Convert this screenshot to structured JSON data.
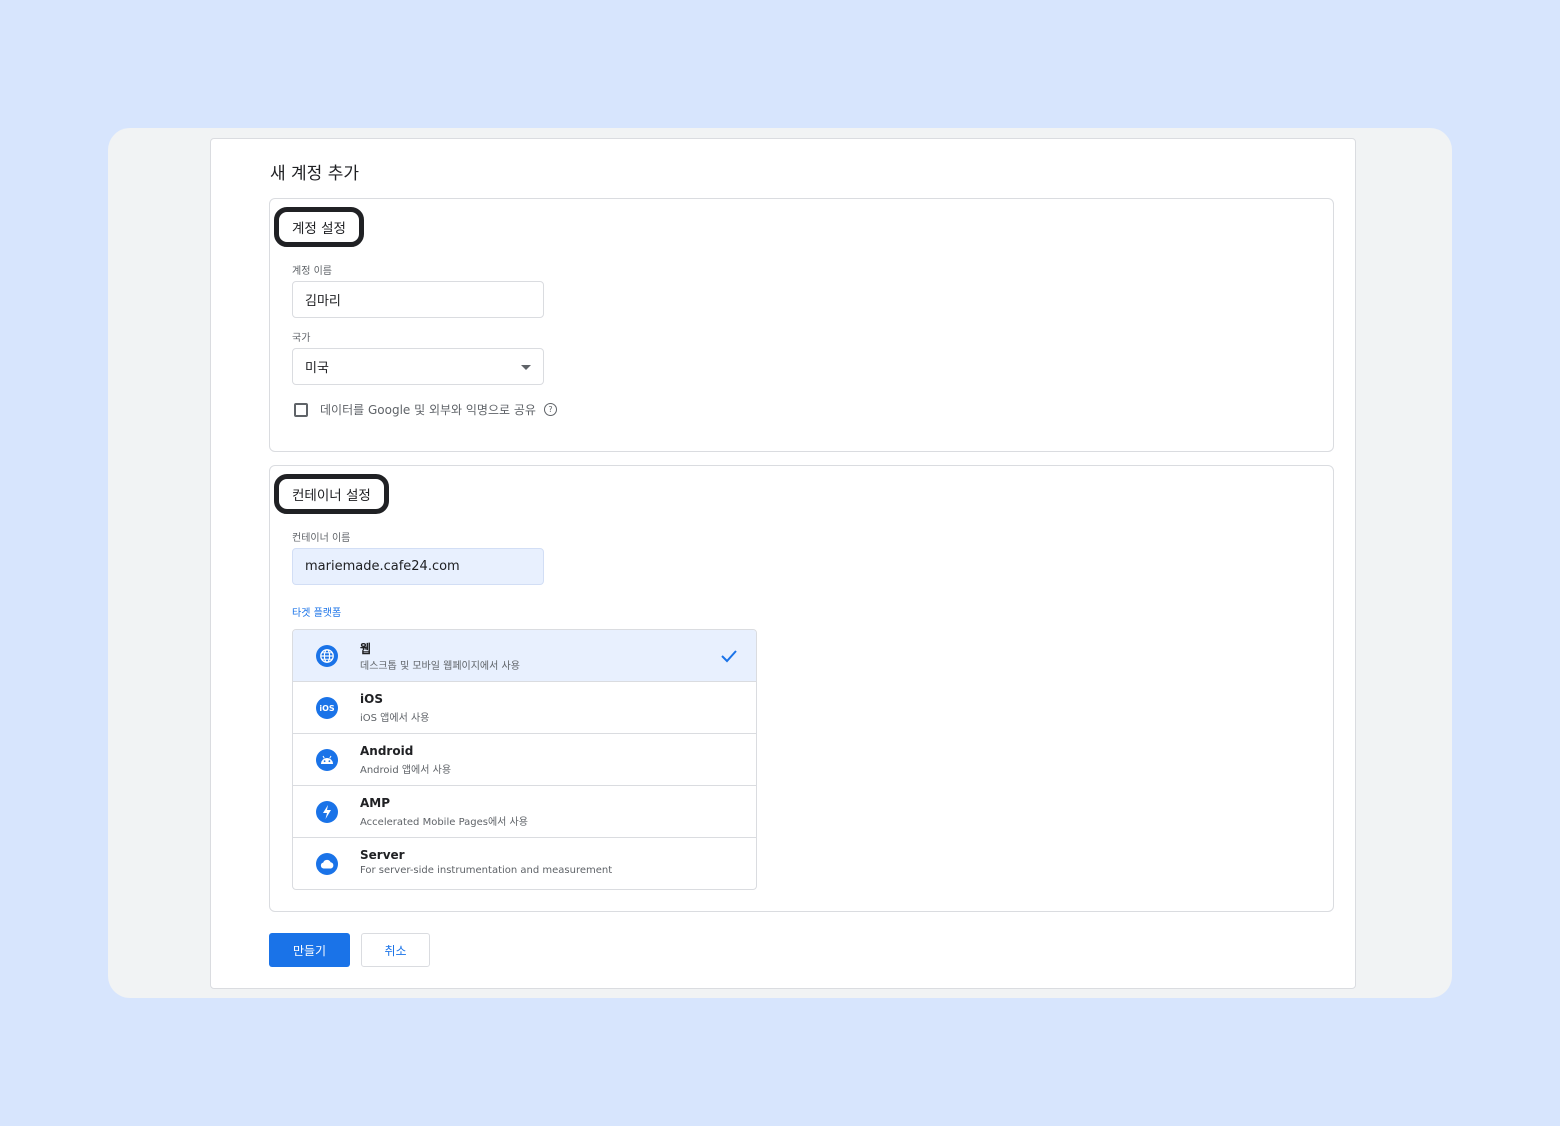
{
  "page": {
    "title": "새 계정 추가"
  },
  "account": {
    "section_title": "계정 설정",
    "name_label": "계정 이름",
    "name_value": "김마리",
    "country_label": "국가",
    "country_value": "미국",
    "share_label": "데이터를 Google 및 외부와 익명으로 공유",
    "help_glyph": "?"
  },
  "container": {
    "section_title": "컨테이너 설정",
    "name_label": "컨테이너 이름",
    "name_value": "mariemade.cafe24.com",
    "platform_label": "타겟 플랫폼",
    "platforms": [
      {
        "name": "웹",
        "desc": "데스크톱 및 모바일 웹페이지에서 사용",
        "icon": "globe-icon",
        "selected": true
      },
      {
        "name": "iOS",
        "desc": "iOS 앱에서 사용",
        "icon": "ios-icon",
        "selected": false
      },
      {
        "name": "Android",
        "desc": "Android 앱에서 사용",
        "icon": "android-icon",
        "selected": false
      },
      {
        "name": "AMP",
        "desc": "Accelerated Mobile Pages에서 사용",
        "icon": "bolt-icon",
        "selected": false
      },
      {
        "name": "Server",
        "desc": "For server-side instrumentation and measurement",
        "icon": "cloud-icon",
        "selected": false
      }
    ],
    "ios_icon_text": "iOS"
  },
  "actions": {
    "create_label": "만들기",
    "cancel_label": "취소"
  },
  "colors": {
    "accent": "#1a73e8",
    "selected_bg": "#e8f0fe",
    "page_bg": "#d7e5fd"
  }
}
